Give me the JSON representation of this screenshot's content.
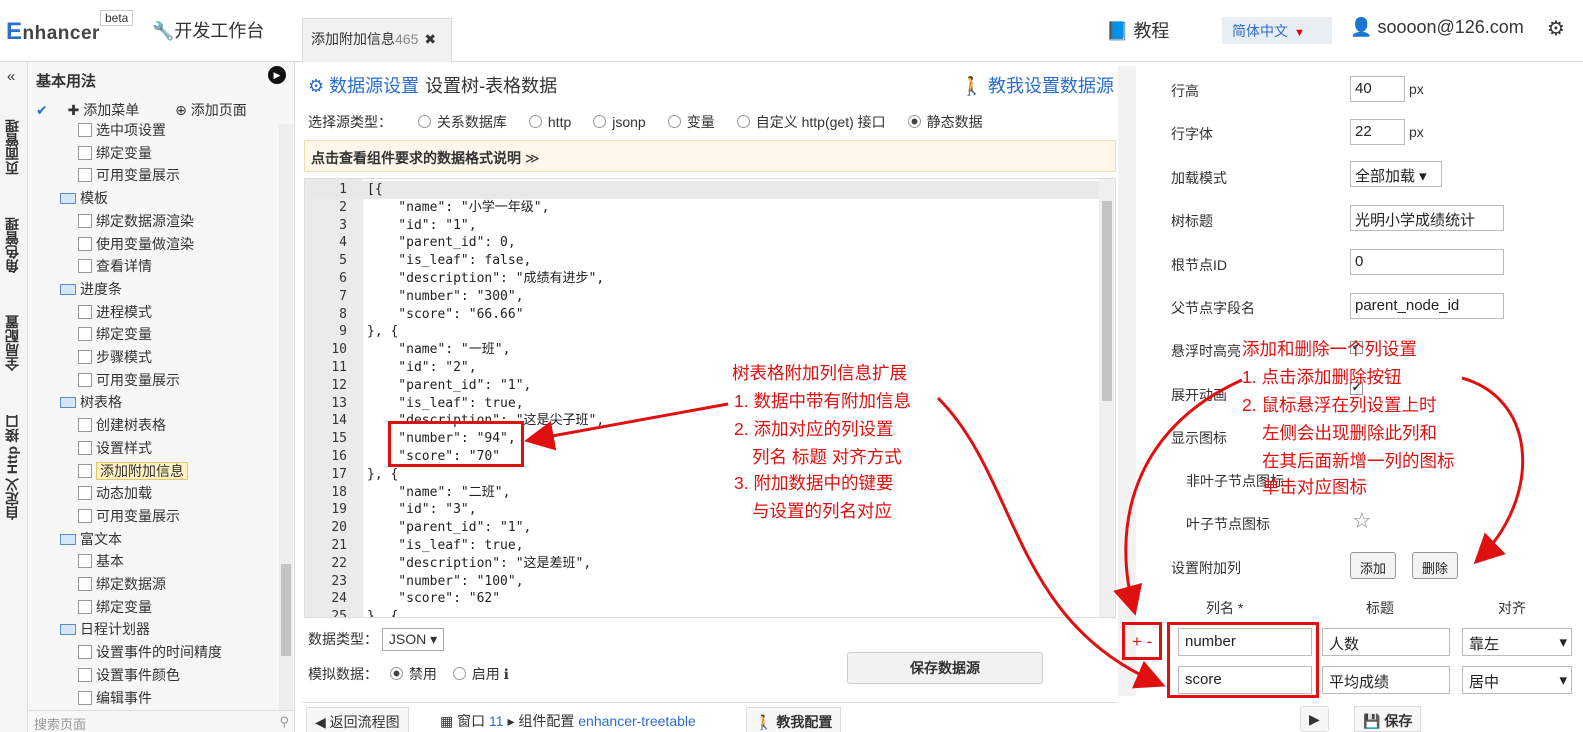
{
  "header": {
    "logo_e": "E",
    "logo_rest": "nhancer",
    "beta": "beta",
    "workbench": "开发工作台",
    "tab_label": "添加附加信息",
    "tab_num": "465",
    "tab_close": "✖",
    "tutorial": "教程",
    "language": "简体中文",
    "user": "soooon@126.com"
  },
  "vnav": {
    "collapse": "«",
    "items": [
      "页面管理",
      "角色管理",
      "全局配置",
      "自定义 Http 接口"
    ]
  },
  "tree": {
    "title": "基本用法",
    "add_menu": "添加菜单",
    "add_page": "添加页面",
    "nodes": [
      "选中项设置",
      "绑定变量",
      "可用变量展示",
      "模板",
      "绑定数据源渲染",
      "使用变量做渲染",
      "查看详情",
      "进度条",
      "进程模式",
      "绑定变量",
      "步骤模式",
      "可用变量展示",
      "树表格",
      "创建树表格",
      "设置样式",
      "添加附加信息",
      "动态加载",
      "可用变量展示",
      "富文本",
      "基本",
      "绑定数据源",
      "绑定变量",
      "日程计划器",
      "设置事件的时间精度",
      "设置事件颜色",
      "编辑事件"
    ],
    "search_placeholder": "搜索页面"
  },
  "datasource": {
    "title": "数据源设置",
    "subtitle": "设置树-表格数据",
    "help": "教我设置数据源",
    "source_type_label": "选择源类型：",
    "source_types": [
      "关系数据库",
      "http",
      "jsonp",
      "变量",
      "自定义 http(get) 接口",
      "静态数据"
    ],
    "selected_source": "静态数据",
    "format_hint": "点击查看组件要求的数据格式说明",
    "code_lines": [
      "[{",
      "    \"name\": \"小学一年级\",",
      "    \"id\": \"1\",",
      "    \"parent_id\": 0,",
      "    \"is_leaf\": false,",
      "    \"description\": \"成绩有进步\",",
      "    \"number\": \"300\",",
      "    \"score\": \"66.66\"",
      "}, {",
      "    \"name\": \"一班\",",
      "    \"id\": \"2\",",
      "    \"parent_id\": \"1\",",
      "    \"is_leaf\": true,",
      "    \"description\": \"这是尖子班\",",
      "    \"number\": \"94\",",
      "    \"score\": \"70\"",
      "}, {",
      "    \"name\": \"二班\",",
      "    \"id\": \"3\",",
      "    \"parent_id\": \"1\",",
      "    \"is_leaf\": true,",
      "    \"description\": \"这是差班\",",
      "    \"number\": \"100\",",
      "    \"score\": \"62\"",
      "}, {"
    ],
    "data_type_label": "数据类型：",
    "data_type": "JSON",
    "mock_label": "模拟数据：",
    "mock_disable": "禁用",
    "mock_enable": "启用",
    "save_button": "保存数据源"
  },
  "bottombar": {
    "back": "返回流程图",
    "window": "窗口",
    "window_num": "11",
    "component_config": "组件配置",
    "component_name": "enhancer-treetable",
    "teach_config": "教我配置"
  },
  "props": {
    "row_height_label": "行高",
    "row_height": "40",
    "unit_px": "px",
    "row_font_label": "行字体",
    "row_font": "22",
    "load_mode_label": "加载模式",
    "load_mode": "全部加载",
    "tree_title_label": "树标题",
    "tree_title": "光明小学成绩统计",
    "root_id_label": "根节点ID",
    "root_id": "0",
    "parent_field_label": "父节点字段名",
    "parent_field": "parent_node_id",
    "hover_highlight_label": "悬浮时高亮",
    "expand_anim_label": "展开动画",
    "show_icon_label": "显示图标",
    "nonleaf_icon_label": "非叶子节点图标",
    "leaf_icon_label": "叶子节点图标",
    "extra_cols_label": "设置附加列",
    "add_button": "添加",
    "delete_button": "删除",
    "col_name_head": "列名 *",
    "col_title_head": "标题",
    "col_align_head": "对齐",
    "plus_minus": "+ -",
    "columns": [
      {
        "name": "number",
        "title": "人数",
        "align": "靠左"
      },
      {
        "name": "score",
        "title": "平均成绩",
        "align": "居中"
      }
    ],
    "save": "保存"
  },
  "annotations": {
    "left": [
      "树表格附加列信息扩展",
      "1. 数据中带有附加信息",
      "2. 添加对应的列设置",
      "列名 标题 对齐方式",
      "3. 附加数据中的键要",
      "与设置的列名对应"
    ],
    "right": [
      "添加和删除一个列设置",
      "1. 点击添加删除按钮",
      "2. 鼠标悬浮在列设置上时",
      "左侧会出现删除此列和",
      "在其后面新增一列的图标",
      "单击对应图标"
    ]
  },
  "colors": {
    "accent": "#2a6fd0",
    "annotation": "#e01010"
  }
}
